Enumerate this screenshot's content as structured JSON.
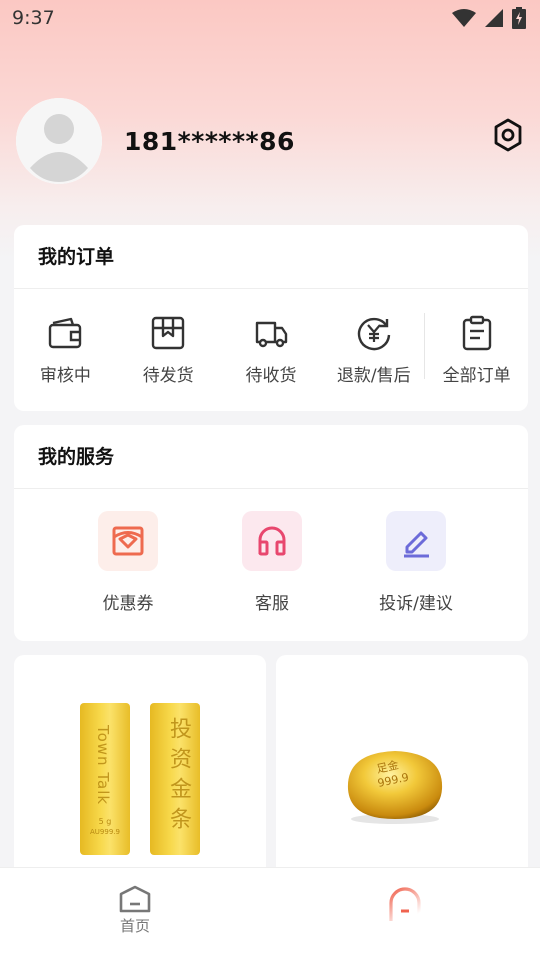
{
  "status_bar": {
    "time": "9:37",
    "icons": [
      "wifi-icon",
      "signal-icon",
      "battery-icon"
    ]
  },
  "profile": {
    "phone": "181******86",
    "avatar_icon": "user-avatar-icon",
    "settings_icon": "gear-icon"
  },
  "orders": {
    "title": "我的订单",
    "items": [
      {
        "label": "审核中",
        "icon": "wallet-icon"
      },
      {
        "label": "待发货",
        "icon": "package-icon"
      },
      {
        "label": "待收货",
        "icon": "truck-icon"
      },
      {
        "label": "退款/售后",
        "icon": "refund-icon"
      },
      {
        "label": "全部订单",
        "icon": "clipboard-icon"
      }
    ]
  },
  "services": {
    "title": "我的服务",
    "items": [
      {
        "label": "优惠券",
        "icon": "coupon-icon",
        "color": "#ee6a4f"
      },
      {
        "label": "客服",
        "icon": "headset-icon",
        "color": "#e8476e"
      },
      {
        "label": "投诉/建议",
        "icon": "edit-icon",
        "color": "#6c6bd9"
      }
    ]
  },
  "products": [
    {
      "image": "gold-bars",
      "bar_left_text": "Town Talk",
      "bar_left_small": "5 g",
      "bar_left_purity": "AU999.9",
      "bar_right_text": "投资金条"
    },
    {
      "image": "gold-nugget",
      "nugget_text_1": "足金",
      "nugget_text_2": "999.9"
    }
  ],
  "tabbar": {
    "tabs": [
      {
        "label": "首页",
        "icon": "home-icon"
      },
      {
        "label": "",
        "icon": "profile-icon"
      }
    ]
  },
  "colors": {
    "accent": "#f0634f",
    "gold": "#f2c93a"
  }
}
